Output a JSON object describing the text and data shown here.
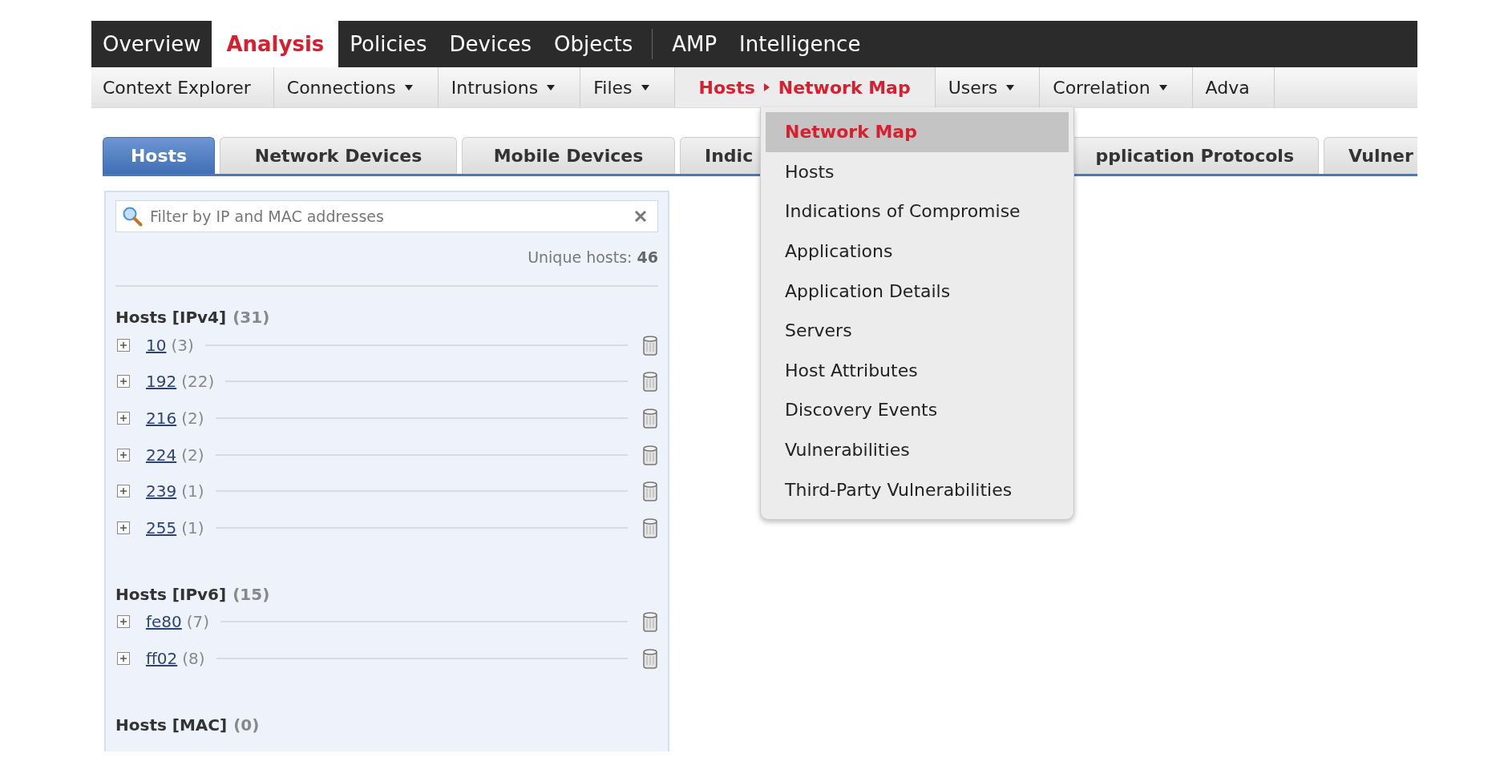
{
  "top_nav": [
    {
      "label": "Overview",
      "selected": false,
      "separator_before": false
    },
    {
      "label": "Analysis",
      "selected": true,
      "separator_before": false
    },
    {
      "label": "Policies",
      "selected": false,
      "separator_before": false
    },
    {
      "label": "Devices",
      "selected": false,
      "separator_before": false
    },
    {
      "label": "Objects",
      "selected": false,
      "separator_before": false
    },
    {
      "label": "AMP",
      "selected": false,
      "separator_before": true
    },
    {
      "label": "Intelligence",
      "selected": false,
      "separator_before": false
    }
  ],
  "sub_nav": [
    {
      "label": "Context Explorer",
      "dropdown": false,
      "selected": false
    },
    {
      "label": "Connections",
      "dropdown": true,
      "selected": false
    },
    {
      "label": "Intrusions",
      "dropdown": true,
      "selected": false
    },
    {
      "label": "Files",
      "dropdown": true,
      "selected": false
    },
    {
      "label": "Hosts",
      "sub": "Network Map",
      "dropdown": false,
      "selected": true
    },
    {
      "label": "Users",
      "dropdown": true,
      "selected": false
    },
    {
      "label": "Correlation",
      "dropdown": true,
      "selected": false
    },
    {
      "label": "Adva",
      "dropdown": false,
      "selected": false
    }
  ],
  "dropdown_menu": [
    {
      "label": "Network Map",
      "selected": true
    },
    {
      "label": "Hosts",
      "selected": false
    },
    {
      "label": "Indications of Compromise",
      "selected": false
    },
    {
      "label": "Applications",
      "selected": false
    },
    {
      "label": "Application Details",
      "selected": false
    },
    {
      "label": "Servers",
      "selected": false
    },
    {
      "label": "Host Attributes",
      "selected": false
    },
    {
      "label": "Discovery Events",
      "selected": false
    },
    {
      "label": "Vulnerabilities",
      "selected": false
    },
    {
      "label": "Third-Party Vulnerabilities",
      "selected": false
    }
  ],
  "tabs": [
    {
      "label": "Hosts",
      "selected": true
    },
    {
      "label": "Network Devices",
      "selected": false
    },
    {
      "label": "Mobile Devices",
      "selected": false
    },
    {
      "label": "Indic",
      "selected": false
    },
    {
      "label": "pplication Protocols",
      "selected": false
    },
    {
      "label": "Vulner",
      "selected": false
    }
  ],
  "panel": {
    "search": {
      "placeholder": "Filter by IP and MAC addresses"
    },
    "unique_hosts": "Unique hosts: **46**",
    "groups": [
      {
        "title": "Hosts [IPv4]",
        "count": "(31)",
        "items": [
          {
            "name": "10",
            "count": "(3)"
          },
          {
            "name": "192",
            "count": "(22)"
          },
          {
            "name": "216",
            "count": "(2)"
          },
          {
            "name": "224",
            "count": "(2)"
          },
          {
            "name": "239",
            "count": "(1)"
          },
          {
            "name": "255",
            "count": "(1)"
          }
        ]
      },
      {
        "title": "Hosts [IPv6]",
        "count": "(15)",
        "items": [
          {
            "name": "fe80",
            "count": "(7)"
          },
          {
            "name": "ff02",
            "count": "(8)"
          }
        ]
      },
      {
        "title": "Hosts [MAC]",
        "count": "(0)"
      }
    ]
  }
}
